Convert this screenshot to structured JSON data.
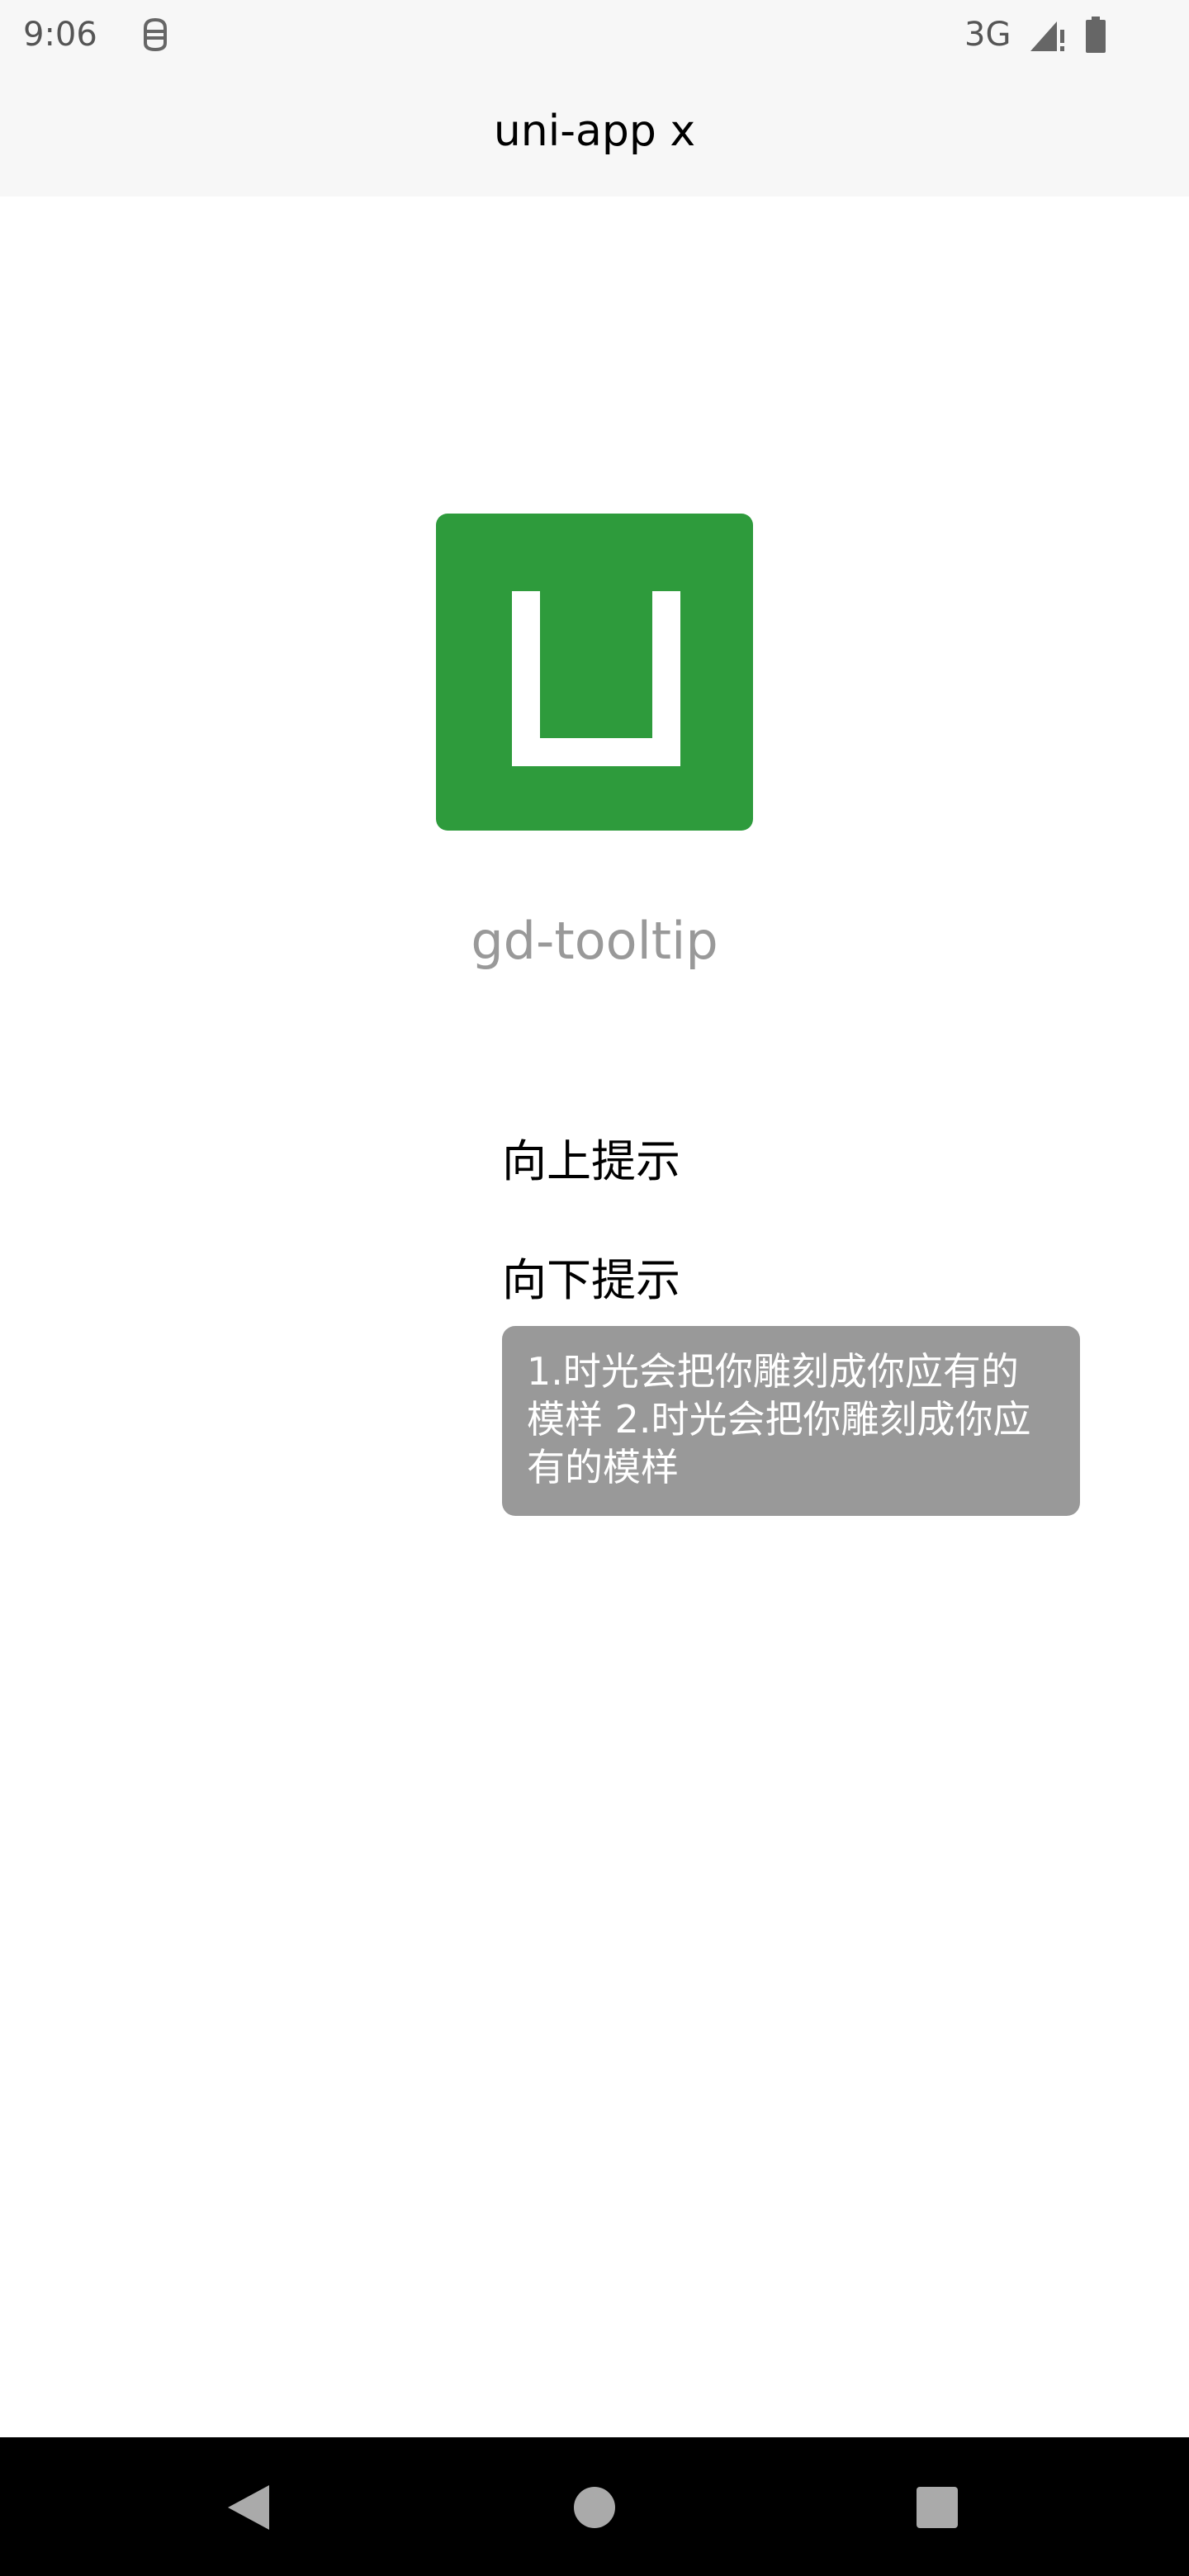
{
  "status_bar": {
    "time": "9:06",
    "network": "3G",
    "icons": [
      "face-icon",
      "signal-icon",
      "battery-icon"
    ]
  },
  "nav": {
    "title": "uni-app x"
  },
  "logo": {
    "caption": "gd-tooltip",
    "color": "#2e9b3c"
  },
  "buttons": {
    "up_label": "向上提示",
    "down_label": "向下提示"
  },
  "tooltip": {
    "text": "1.时光会把你雕刻成你应有的模样 2.时光会把你雕刻成你应有的模样",
    "background": "#999999"
  },
  "system_nav": {
    "icons": [
      "back-icon",
      "home-icon",
      "recent-apps-icon"
    ]
  }
}
